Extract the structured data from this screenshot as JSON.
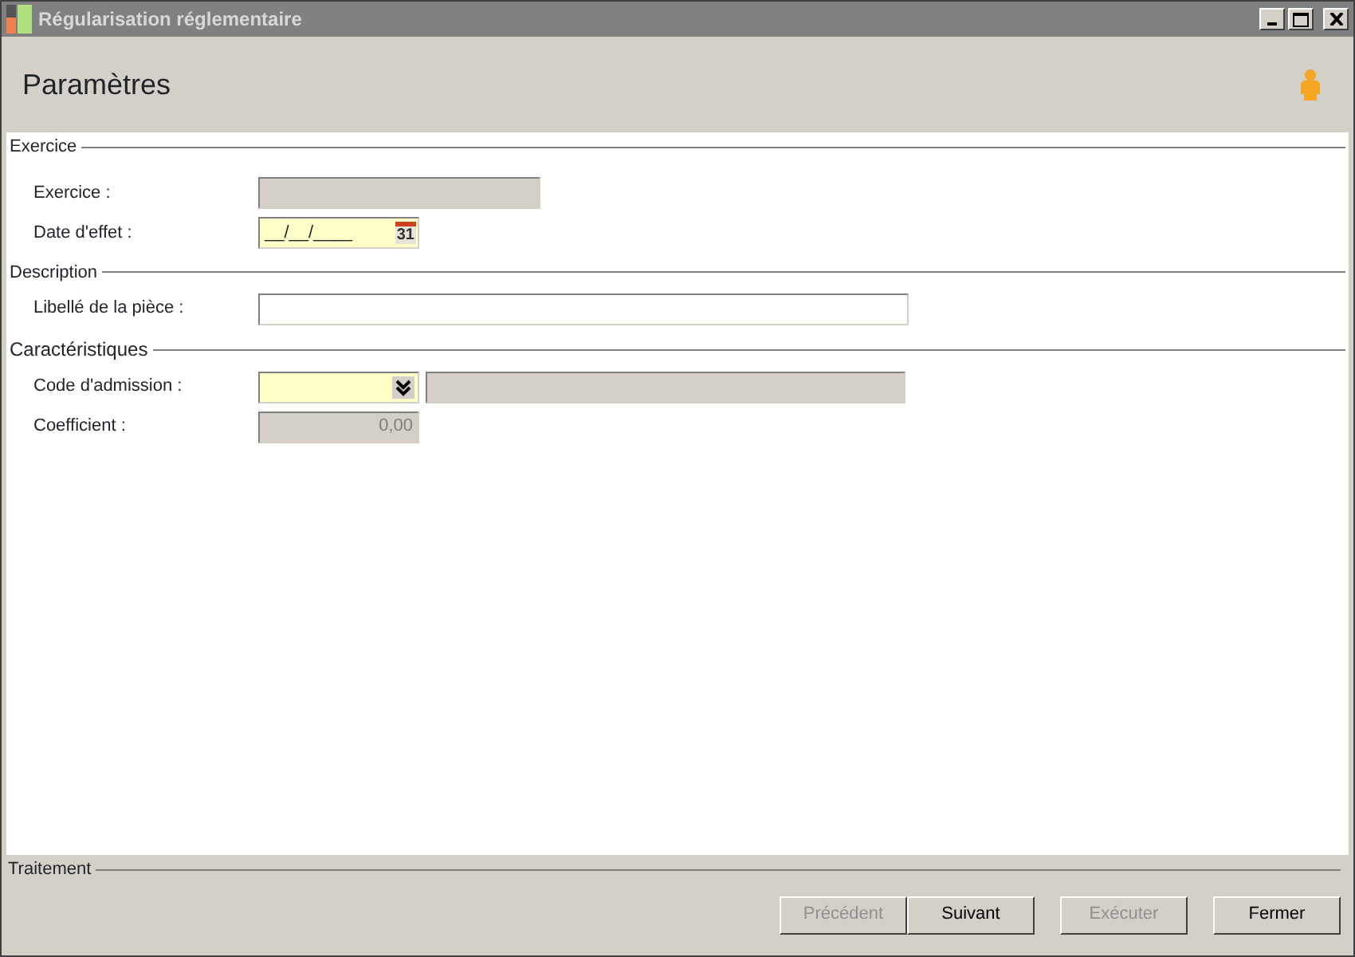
{
  "window": {
    "title": "Régularisation réglementaire"
  },
  "header": {
    "title": "Paramètres"
  },
  "sections": [
    {
      "title": "Exercice",
      "fields": [
        {
          "label": "Exercice :",
          "kind": "text",
          "disabled": true
        },
        {
          "label": "Date d'effet :",
          "kind": "date",
          "disabled": false,
          "value": "__/__/____",
          "icon": "31"
        }
      ]
    },
    {
      "title": "Description",
      "fields": [
        {
          "label": "Libellé de la pièce :",
          "kind": "longtext",
          "disabled": false
        }
      ]
    },
    {
      "title": "Caractéristiques",
      "fields": [
        {
          "label": "Code d'admission :",
          "kind": "combo",
          "disabled": false
        },
        {
          "label": "Coefficient :",
          "kind": "number",
          "disabled": true,
          "value": "0,00"
        }
      ]
    }
  ],
  "footer": {
    "title": "Traitement",
    "buttons": [
      {
        "label": "Précédent",
        "disabled": true
      },
      {
        "label": "Suivant",
        "disabled": false
      },
      {
        "label": "Exécuter",
        "disabled": true
      },
      {
        "label": "Fermer",
        "disabled": false
      }
    ]
  }
}
